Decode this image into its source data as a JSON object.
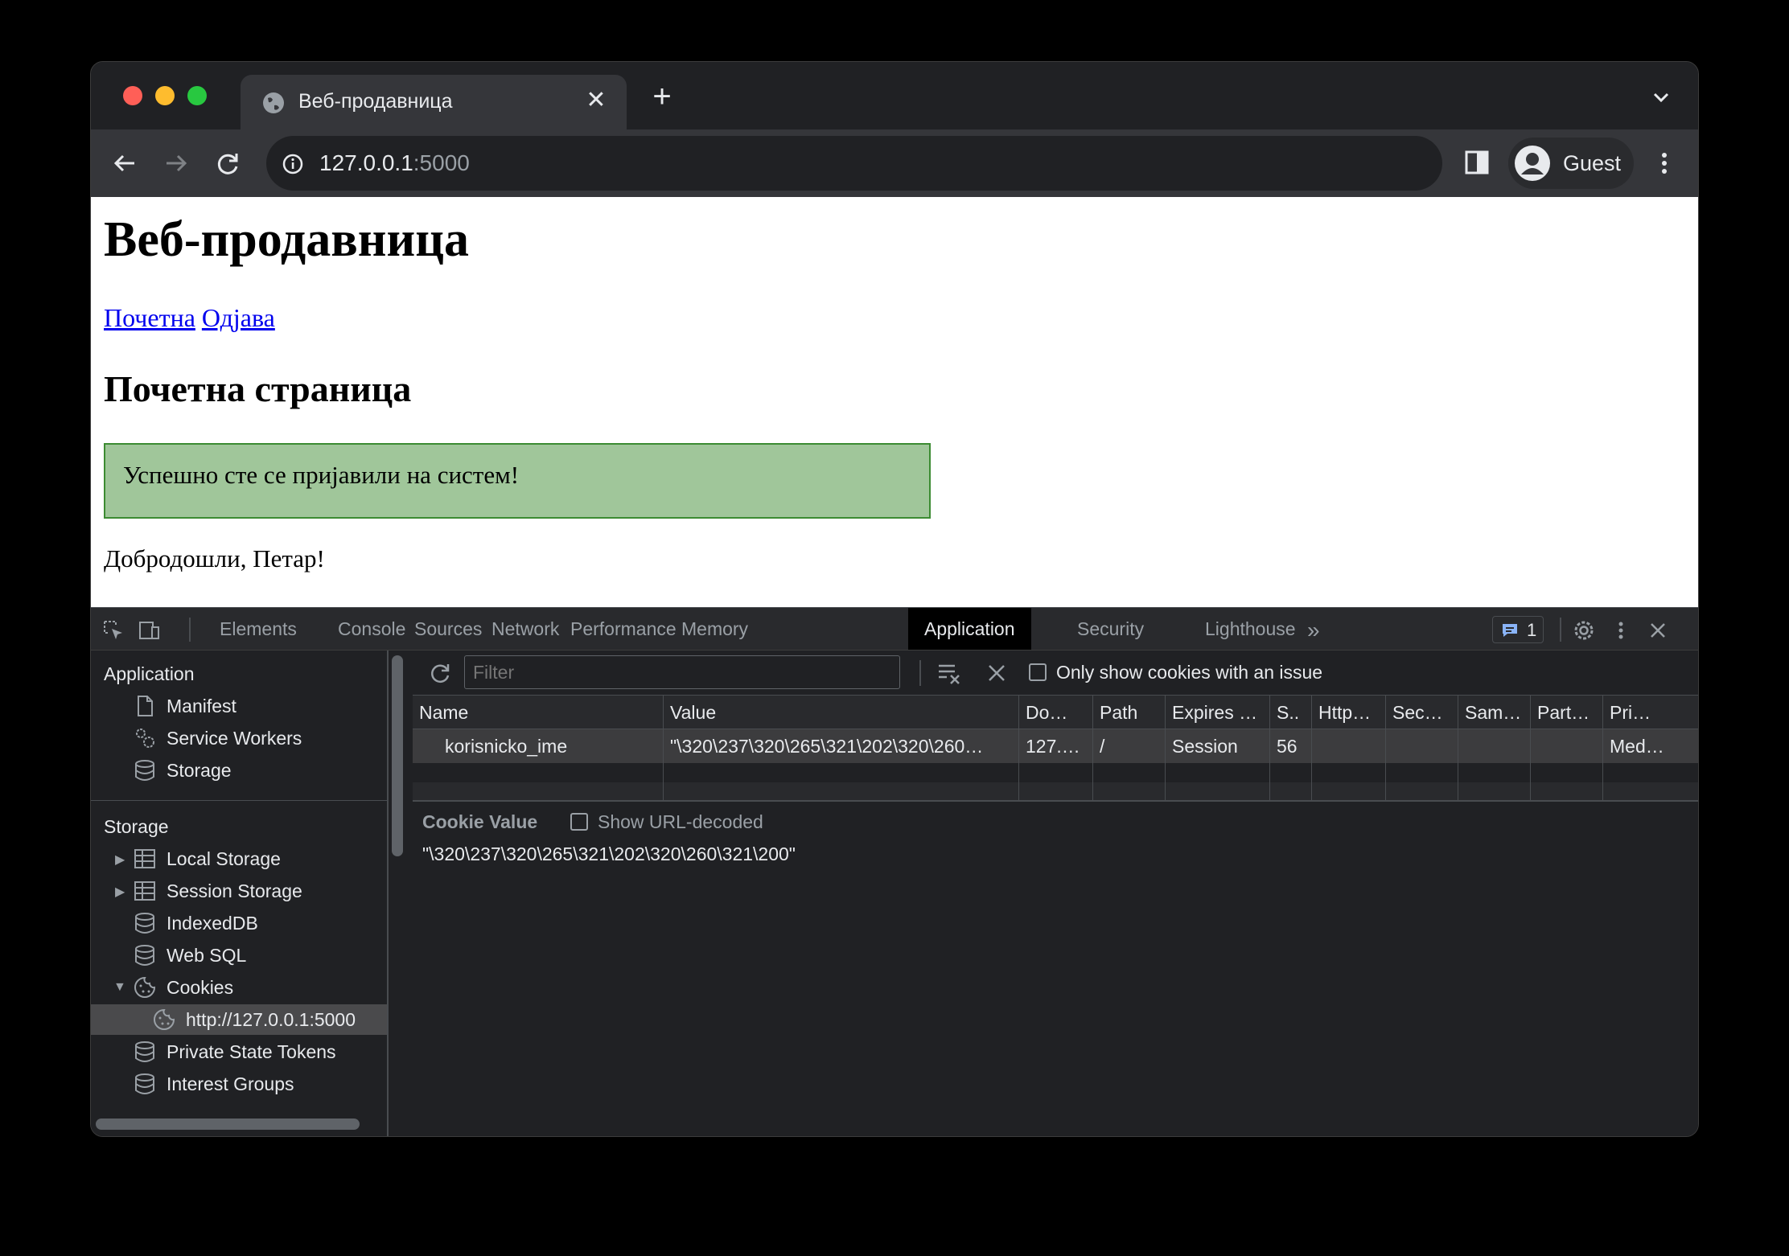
{
  "browser": {
    "tab_title": "Веб-продавница",
    "url_host": "127.0.0.1",
    "url_port": ":5000",
    "profile_label": "Guest"
  },
  "page": {
    "title": "Веб-продавница",
    "nav_home": "Почетна",
    "nav_logout": "Одјава",
    "subtitle": "Почетна страница",
    "flash_message": "Успешно сте се пријавили на систем!",
    "welcome": "Добродошли, Петар!"
  },
  "devtools": {
    "tabs": [
      "Elements",
      "Console",
      "Sources",
      "Network",
      "Performance",
      "Memory",
      "Application",
      "Security",
      "Lighthouse"
    ],
    "active_tab": "Application",
    "issues_count": "1",
    "sidebar": {
      "application_header": "Application",
      "application_items": [
        "Manifest",
        "Service Workers",
        "Storage"
      ],
      "storage_header": "Storage",
      "storage_items": [
        "Local Storage",
        "Session Storage",
        "IndexedDB",
        "Web SQL",
        "Cookies"
      ],
      "cookie_origin": "http://127.0.0.1:5000",
      "more_items": [
        "Private State Tokens",
        "Interest Groups"
      ]
    },
    "filter_placeholder": "Filter",
    "only_issues_label": "Only show cookies with an issue",
    "columns": [
      "Name",
      "Value",
      "Do…",
      "Path",
      "Expires …",
      "S..",
      "Http…",
      "Sec…",
      "Sam…",
      "Part…",
      "Pri…"
    ],
    "cookie_row": [
      "korisnicko_ime",
      "\"\\320\\237\\320\\265\\321\\202\\320\\260…",
      "127.…",
      "/",
      "Session",
      "56",
      "",
      "",
      "",
      "",
      "Med…"
    ],
    "cookie_value_title": "Cookie Value",
    "show_url_decoded_label": "Show URL-decoded",
    "cookie_value": "\"\\320\\237\\320\\265\\321\\202\\320\\260\\321\\200\""
  },
  "colors": {
    "flash_bg": "#a0c69a",
    "flash_border": "#3c8b32",
    "link": "#0000ee",
    "devtools_bg": "#202124"
  }
}
